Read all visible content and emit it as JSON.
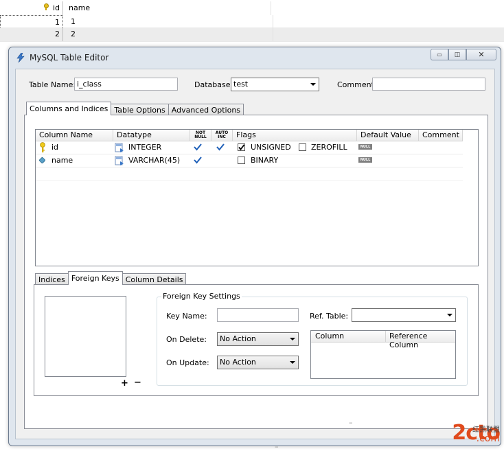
{
  "background_grid": {
    "headers": [
      "id",
      "name"
    ],
    "rows": [
      {
        "id": "1",
        "name": "1"
      },
      {
        "id": "2",
        "name": "2"
      }
    ]
  },
  "window": {
    "title": "MySQL Table Editor",
    "controls": {
      "minimize": "▭",
      "restore": "◫",
      "close": "✕"
    }
  },
  "form": {
    "table_name_label": "Table Name:",
    "table_name_value": "i_class",
    "database_label": "Database:",
    "database_value": "test",
    "comment_label": "Comment:",
    "comment_value": ""
  },
  "main_tabs": [
    "Columns and Indices",
    "Table Options",
    "Advanced Options"
  ],
  "columns_grid": {
    "headers": {
      "column_name": "Column Name",
      "datatype": "Datatype",
      "not_null": "NOT NULL",
      "auto_inc": "AUTO INC",
      "flags": "Flags",
      "default_value": "Default Value",
      "comment": "Comment"
    },
    "rows": [
      {
        "name": "id",
        "datatype": "INTEGER",
        "not_null": true,
        "auto_inc": true,
        "flags": [
          {
            "label": "UNSIGNED",
            "checked": true
          },
          {
            "label": "ZEROFILL",
            "checked": false
          }
        ],
        "default": "NULL",
        "icon": "primary-key-icon"
      },
      {
        "name": "name",
        "datatype": "VARCHAR(45)",
        "not_null": true,
        "auto_inc": false,
        "flags": [
          {
            "label": "BINARY",
            "checked": false
          }
        ],
        "default": "NULL",
        "icon": "column-diamond-icon"
      }
    ]
  },
  "sub_tabs": [
    "Indices",
    "Foreign Keys",
    "Column Details"
  ],
  "foreign_keys": {
    "add_label": "+",
    "remove_label": "−",
    "settings_title": "Foreign Key Settings",
    "key_name_label": "Key Name:",
    "key_name_value": "",
    "ref_table_label": "Ref. Table:",
    "ref_table_value": "",
    "on_delete_label": "On Delete:",
    "on_delete_value": "No Action",
    "on_update_label": "On Update:",
    "on_update_value": "No Action",
    "ref_columns_headers": [
      "Column",
      "Reference Column"
    ]
  },
  "watermark": {
    "text": "2cto",
    "suffix": ".com",
    "cn": "红黑联盟"
  },
  "colors": {
    "window_frame": "#dfe6ee",
    "client": "#f0f0f0",
    "check": "#1e5fb8",
    "watermark": "#d83a1a"
  }
}
